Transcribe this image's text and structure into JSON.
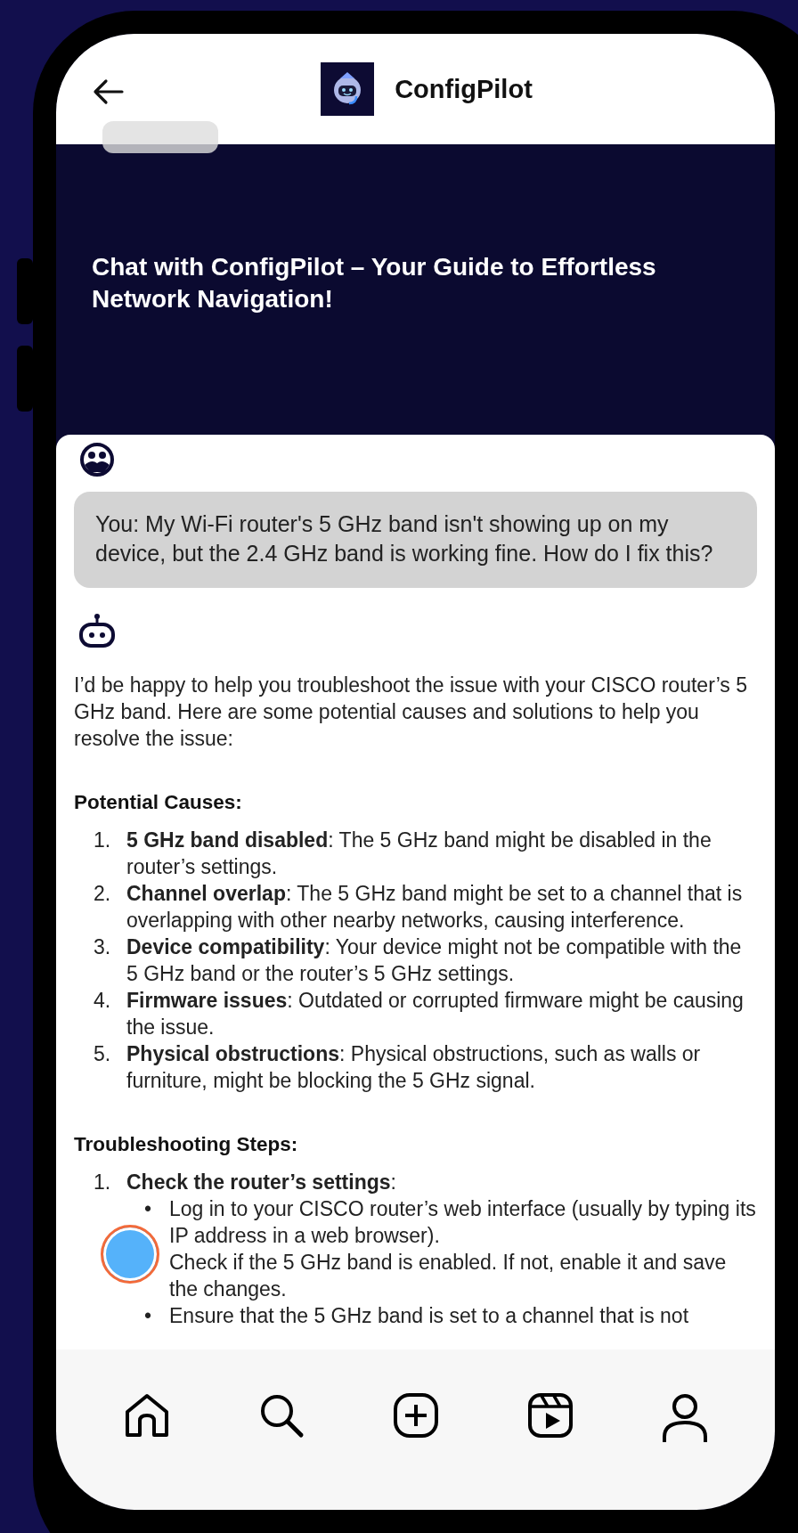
{
  "header": {
    "title": "ConfigPilot"
  },
  "banner": {
    "title": "Chat with ConfigPilot – Your Guide to Effortless Network Navigation!"
  },
  "chat": {
    "user_message": "You: My Wi-Fi router's 5 GHz band isn't showing up on my device, but the 2.4 GHz band is working fine. How do I fix this?",
    "bot_intro": "I’d be happy to help you troubleshoot the issue with your CISCO router’s 5 GHz band. Here are some potential causes and solutions to help you resolve the issue:",
    "sections": [
      {
        "heading": "Potential Causes:",
        "items": [
          {
            "number": "1.",
            "text": "**5 GHz band disabled**: The 5 GHz band might be disabled in the router’s settings."
          },
          {
            "number": "2.",
            "text": "**Channel overlap**: The 5 GHz band might be set to a channel that is overlapping with other nearby networks, causing interference."
          },
          {
            "number": "3.",
            "text": "**Device compatibility**: Your device might not be compatible with the 5 GHz band or the router’s 5 GHz settings."
          },
          {
            "number": "4.",
            "text": "**Firmware issues**: Outdated or corrupted firmware might be causing the issue."
          },
          {
            "number": "5.",
            "text": "**Physical obstructions**: Physical obstructions, such as walls or furniture, might be blocking the 5 GHz signal."
          }
        ]
      },
      {
        "heading": "Troubleshooting Steps:",
        "items": [
          {
            "number": "1.",
            "text": "**Check the router’s settings**:",
            "bullets": [
              {
                "marker": "•",
                "text": "Log in to your CISCO router’s web interface (usually by typing its IP address in a web browser)."
              },
              {
                "text": "Check if the 5 GHz band is enabled. If not, enable it and save the changes."
              },
              {
                "marker": "•",
                "text": "Ensure that the 5 GHz band is set to a channel that is not"
              }
            ]
          }
        ]
      }
    ]
  },
  "nav": [
    {
      "kind": "home"
    },
    {
      "kind": "search"
    },
    {
      "kind": "add"
    },
    {
      "kind": "reels"
    },
    {
      "kind": "profile"
    }
  ]
}
